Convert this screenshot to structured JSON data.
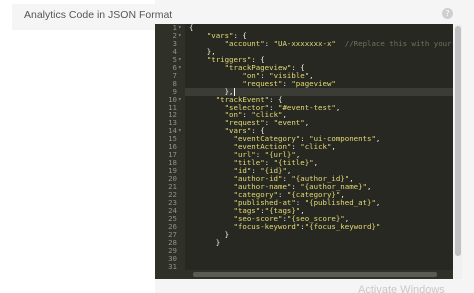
{
  "field": {
    "label": "Analytics Code in JSON Format",
    "help_icon": "question-mark-icon"
  },
  "editor": {
    "active_line": 9,
    "lines": [
      {
        "n": "1",
        "fold": "▾",
        "text": "{"
      },
      {
        "n": "2",
        "fold": "▾",
        "text": "    \"vars\": {"
      },
      {
        "n": "3",
        "fold": "",
        "text": "        \"account\": \"UA-xxxxxxx-x\"  //Replace this with your Tra"
      },
      {
        "n": "4",
        "fold": "",
        "text": "    },"
      },
      {
        "n": "5",
        "fold": "▾",
        "text": "    \"triggers\": {"
      },
      {
        "n": "6",
        "fold": "▾",
        "text": "        \"trackPageview\": {"
      },
      {
        "n": "7",
        "fold": "",
        "text": "            \"on\": \"visible\","
      },
      {
        "n": "8",
        "fold": "",
        "text": "            \"request\": \"pageview\""
      },
      {
        "n": "9",
        "fold": "",
        "text": "        },"
      },
      {
        "n": "10",
        "fold": "▾",
        "text": "      \"trackEvent\": {"
      },
      {
        "n": "11",
        "fold": "",
        "text": "        \"selector\": \"#event-test\","
      },
      {
        "n": "12",
        "fold": "",
        "text": "        \"on\": \"click\","
      },
      {
        "n": "13",
        "fold": "",
        "text": "        \"request\": \"event\","
      },
      {
        "n": "14",
        "fold": "▾",
        "text": "        \"vars\": {"
      },
      {
        "n": "15",
        "fold": "",
        "text": "          \"eventCategory\": \"ui-components\","
      },
      {
        "n": "16",
        "fold": "",
        "text": "          \"eventAction\": \"click\","
      },
      {
        "n": "17",
        "fold": "",
        "text": "          \"url\": \"{url}\","
      },
      {
        "n": "18",
        "fold": "",
        "text": "          \"title\": \"{title}\","
      },
      {
        "n": "19",
        "fold": "",
        "text": "          \"id\": \"{id}\","
      },
      {
        "n": "20",
        "fold": "",
        "text": "          \"author-id\": \"{author_id}\","
      },
      {
        "n": "21",
        "fold": "",
        "text": "          \"author-name\": \"{author_name}\","
      },
      {
        "n": "22",
        "fold": "",
        "text": "          \"category\": \"{category}\","
      },
      {
        "n": "23",
        "fold": "",
        "text": "          \"published-at\": \"{published_at}\","
      },
      {
        "n": "24",
        "fold": "",
        "text": "          \"tags\":\"{tags}\","
      },
      {
        "n": "25",
        "fold": "",
        "text": "          \"seo-score\":\"{seo_score}\","
      },
      {
        "n": "26",
        "fold": "",
        "text": "          \"focus-keyword\":\"{focus_keyword}\""
      },
      {
        "n": "27",
        "fold": "",
        "text": "        }"
      },
      {
        "n": "28",
        "fold": "",
        "text": "      }"
      },
      {
        "n": "29",
        "fold": "",
        "text": ""
      },
      {
        "n": "30",
        "fold": "",
        "text": ""
      },
      {
        "n": "31",
        "fold": "",
        "text": ""
      }
    ]
  },
  "watermark": "Activate Windows",
  "colors": {
    "editor_bg": "#272822",
    "gutter_bg": "#2f3129",
    "string": "#e6db74",
    "comment": "#75715e",
    "punctuation": "#f8f8f2"
  }
}
